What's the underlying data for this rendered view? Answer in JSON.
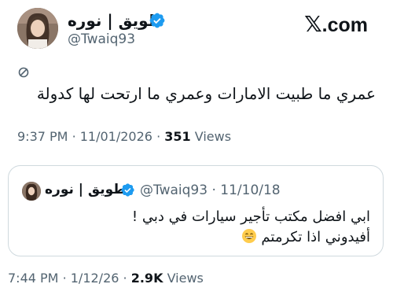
{
  "brand": {
    "mark": "𝕏",
    "domain": ".com"
  },
  "author": {
    "display_name": "طويق | نوره",
    "handle": "@Twaiq93",
    "verified_icon": "verified-badge-icon",
    "verified_color": "#1d9bf0"
  },
  "tweet": {
    "restricted_icon": "reply-restricted-icon",
    "text": "عمري ما طبيت الامارات وعمري ما ارتحت لها كدولة",
    "time": "9:37 PM",
    "separator": "·",
    "date": "11/01/2026",
    "views_count": "351",
    "views_label": "Views"
  },
  "quoted_tweet": {
    "display_name": "طويق | نوره",
    "handle": "@Twaiq93",
    "separator": "·",
    "date": "11/10/18",
    "line1": "ابي افضل مكتب تأجير سيارات في دبي !",
    "line2": "أفيدوني اذا تكرمتم",
    "emoji": "grinning-face-emoji",
    "time": "7:44 PM",
    "time_separator": "·",
    "post_date": "1/12/26",
    "views_count": "2.9K",
    "views_label": "Views"
  },
  "colors": {
    "text": "#0f1419",
    "secondary": "#536471",
    "border": "#cfd9de",
    "verified": "#1d9bf0"
  }
}
